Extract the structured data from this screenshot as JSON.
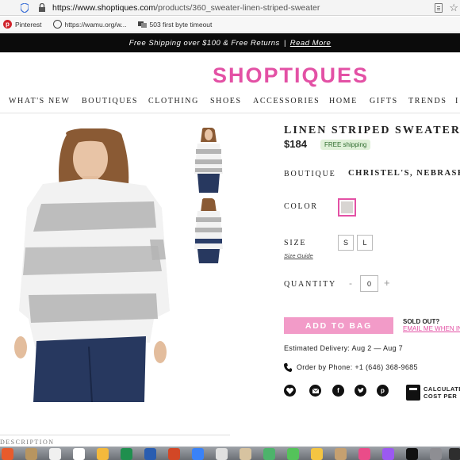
{
  "browser": {
    "url_domain": "https://www.shoptiques.com",
    "url_path": "/products/360_sweater-linen-striped-sweater",
    "bookmarks": [
      {
        "label": "Pinterest",
        "icon": "pinterest-icon"
      },
      {
        "label": "https://wamu.org/w...",
        "icon": "globe-icon"
      },
      {
        "label": "503 first byte timeout",
        "icon": "bookmark-app-icon"
      }
    ]
  },
  "banner": {
    "text": "Free Shipping over $100 & Free Returns",
    "separator": "|",
    "link": "Read More"
  },
  "logo": "SHOPTIQUES",
  "nav": [
    "WHAT'S NEW",
    "BOUTIQUES",
    "CLOTHING",
    "SHOES",
    "ACCESSORIES",
    "HOME",
    "GIFTS",
    "TRENDS",
    "I"
  ],
  "product": {
    "title": "LINEN STRIPED SWEATER",
    "price": "$184",
    "shipping_badge": "FREE shipping",
    "boutique_label": "BOUTIQUE",
    "boutique_value": "CHRISTEL'S, NEBRASKA",
    "color_label": "COLOR",
    "size_label": "SIZE",
    "sizes": [
      "S",
      "L"
    ],
    "size_guide": "Size Guide",
    "quantity_label": "QUANTITY",
    "quantity_minus": "-",
    "quantity_value": "0",
    "quantity_plus": "+",
    "add_to_bag": "ADD TO BAG",
    "sold_out": "SOLD OUT?",
    "email_me": "EMAIL ME WHEN IN",
    "delivery": "Estimated Delivery: Aug 2 — Aug 7",
    "phone": "Order by Phone: +1 (646) 368-9685",
    "share_icons": [
      "heart-icon",
      "email-icon",
      "facebook-icon",
      "twitter-icon",
      "pinterest-icon"
    ],
    "calc_line1": "CALCULATE",
    "calc_line2": "COST PER"
  },
  "description_heading": "DESCRIPTION",
  "colors": {
    "brand_pink": "#e351a5",
    "button_pink": "#f29bc8",
    "banner_bg": "#0b0b0b",
    "badge_green": "#dff0d8"
  }
}
